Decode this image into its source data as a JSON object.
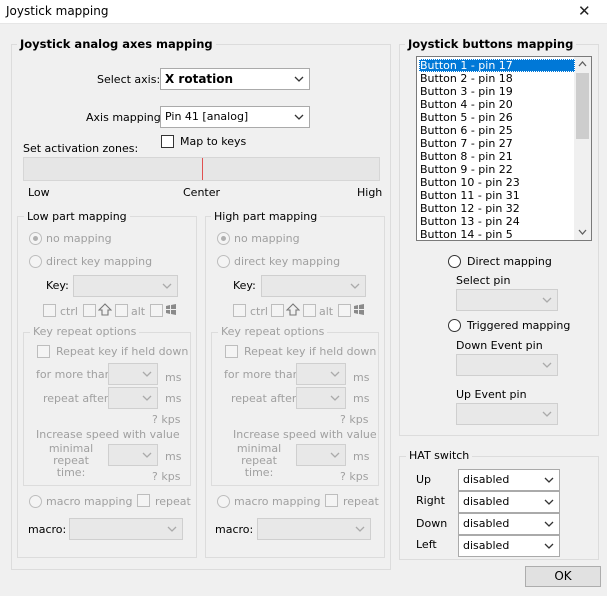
{
  "window": {
    "title": "Joystick mapping",
    "close_glyph": "✕"
  },
  "axes": {
    "group_title": "Joystick analog axes mapping",
    "select_axis_label": "Select axis:",
    "select_axis_value": "X rotation",
    "axis_mapping_label": "Axis mapping:",
    "axis_mapping_value": "Pin 41 [analog]",
    "map_to_keys_label": "Map to keys",
    "activation_label": "Set activation zones:",
    "scale": {
      "low": "Low",
      "center": "Center",
      "high": "High"
    },
    "center_marker_value": 0.5,
    "low_part": {
      "title": "Low part mapping",
      "no_mapping": "no mapping",
      "direct_key_mapping": "direct key mapping",
      "key_label": "Key:",
      "ctrl": "ctrl",
      "alt": "alt",
      "key_repeat_title": "Key repeat options",
      "repeat_if_held": "Repeat key if held down",
      "for_more_than": "for more than",
      "repeat_after": "repeat after",
      "ms": "ms",
      "kps": "? kps",
      "increase_speed": "Increase speed with value",
      "minimal_repeat_time": "minimal\nrepeat time:",
      "macro_mapping": "macro mapping",
      "repeat": "repeat",
      "macro_label": "macro:"
    },
    "high_part": {
      "title": "High part mapping",
      "no_mapping": "no mapping",
      "direct_key_mapping": "direct key mapping",
      "key_label": "Key:",
      "ctrl": "ctrl",
      "alt": "alt",
      "key_repeat_title": "Key repeat options",
      "repeat_if_held": "Repeat key if held down",
      "for_more_than": "for more than",
      "repeat_after": "repeat after",
      "ms": "ms",
      "kps": "? kps",
      "increase_speed": "Increase speed with value",
      "minimal_repeat_time": "minimal\nrepeat time:",
      "macro_mapping": "macro mapping",
      "repeat": "repeat",
      "macro_label": "macro:"
    }
  },
  "buttons_mapping": {
    "group_title": "Joystick buttons mapping",
    "items": [
      "Button 1 - pin 17",
      "Button 2 - pin 18",
      "Button 3 - pin 19",
      "Button 4 - pin 20",
      "Button 5 - pin 26",
      "Button 6 - pin 25",
      "Button 7 - pin 27",
      "Button 8 - pin 21",
      "Button 9 - pin 22",
      "Button 10 - pin 23",
      "Button 11 - pin 31",
      "Button 12 - pin 32",
      "Button 13 - pin 24",
      "Button 14 - pin 5"
    ],
    "direct_mapping": "Direct mapping",
    "select_pin": "Select pin",
    "triggered_mapping": "Triggered mapping",
    "down_event_pin": "Down Event pin",
    "up_event_pin": "Up Event pin"
  },
  "hat": {
    "group_title": "HAT switch",
    "rows": [
      {
        "label": "Up",
        "value": "disabled"
      },
      {
        "label": "Right",
        "value": "disabled"
      },
      {
        "label": "Down",
        "value": "disabled"
      },
      {
        "label": "Left",
        "value": "disabled"
      }
    ]
  },
  "ok_label": "OK",
  "colors": {
    "selection": "#0078d7",
    "center_marker": "#e05050"
  }
}
